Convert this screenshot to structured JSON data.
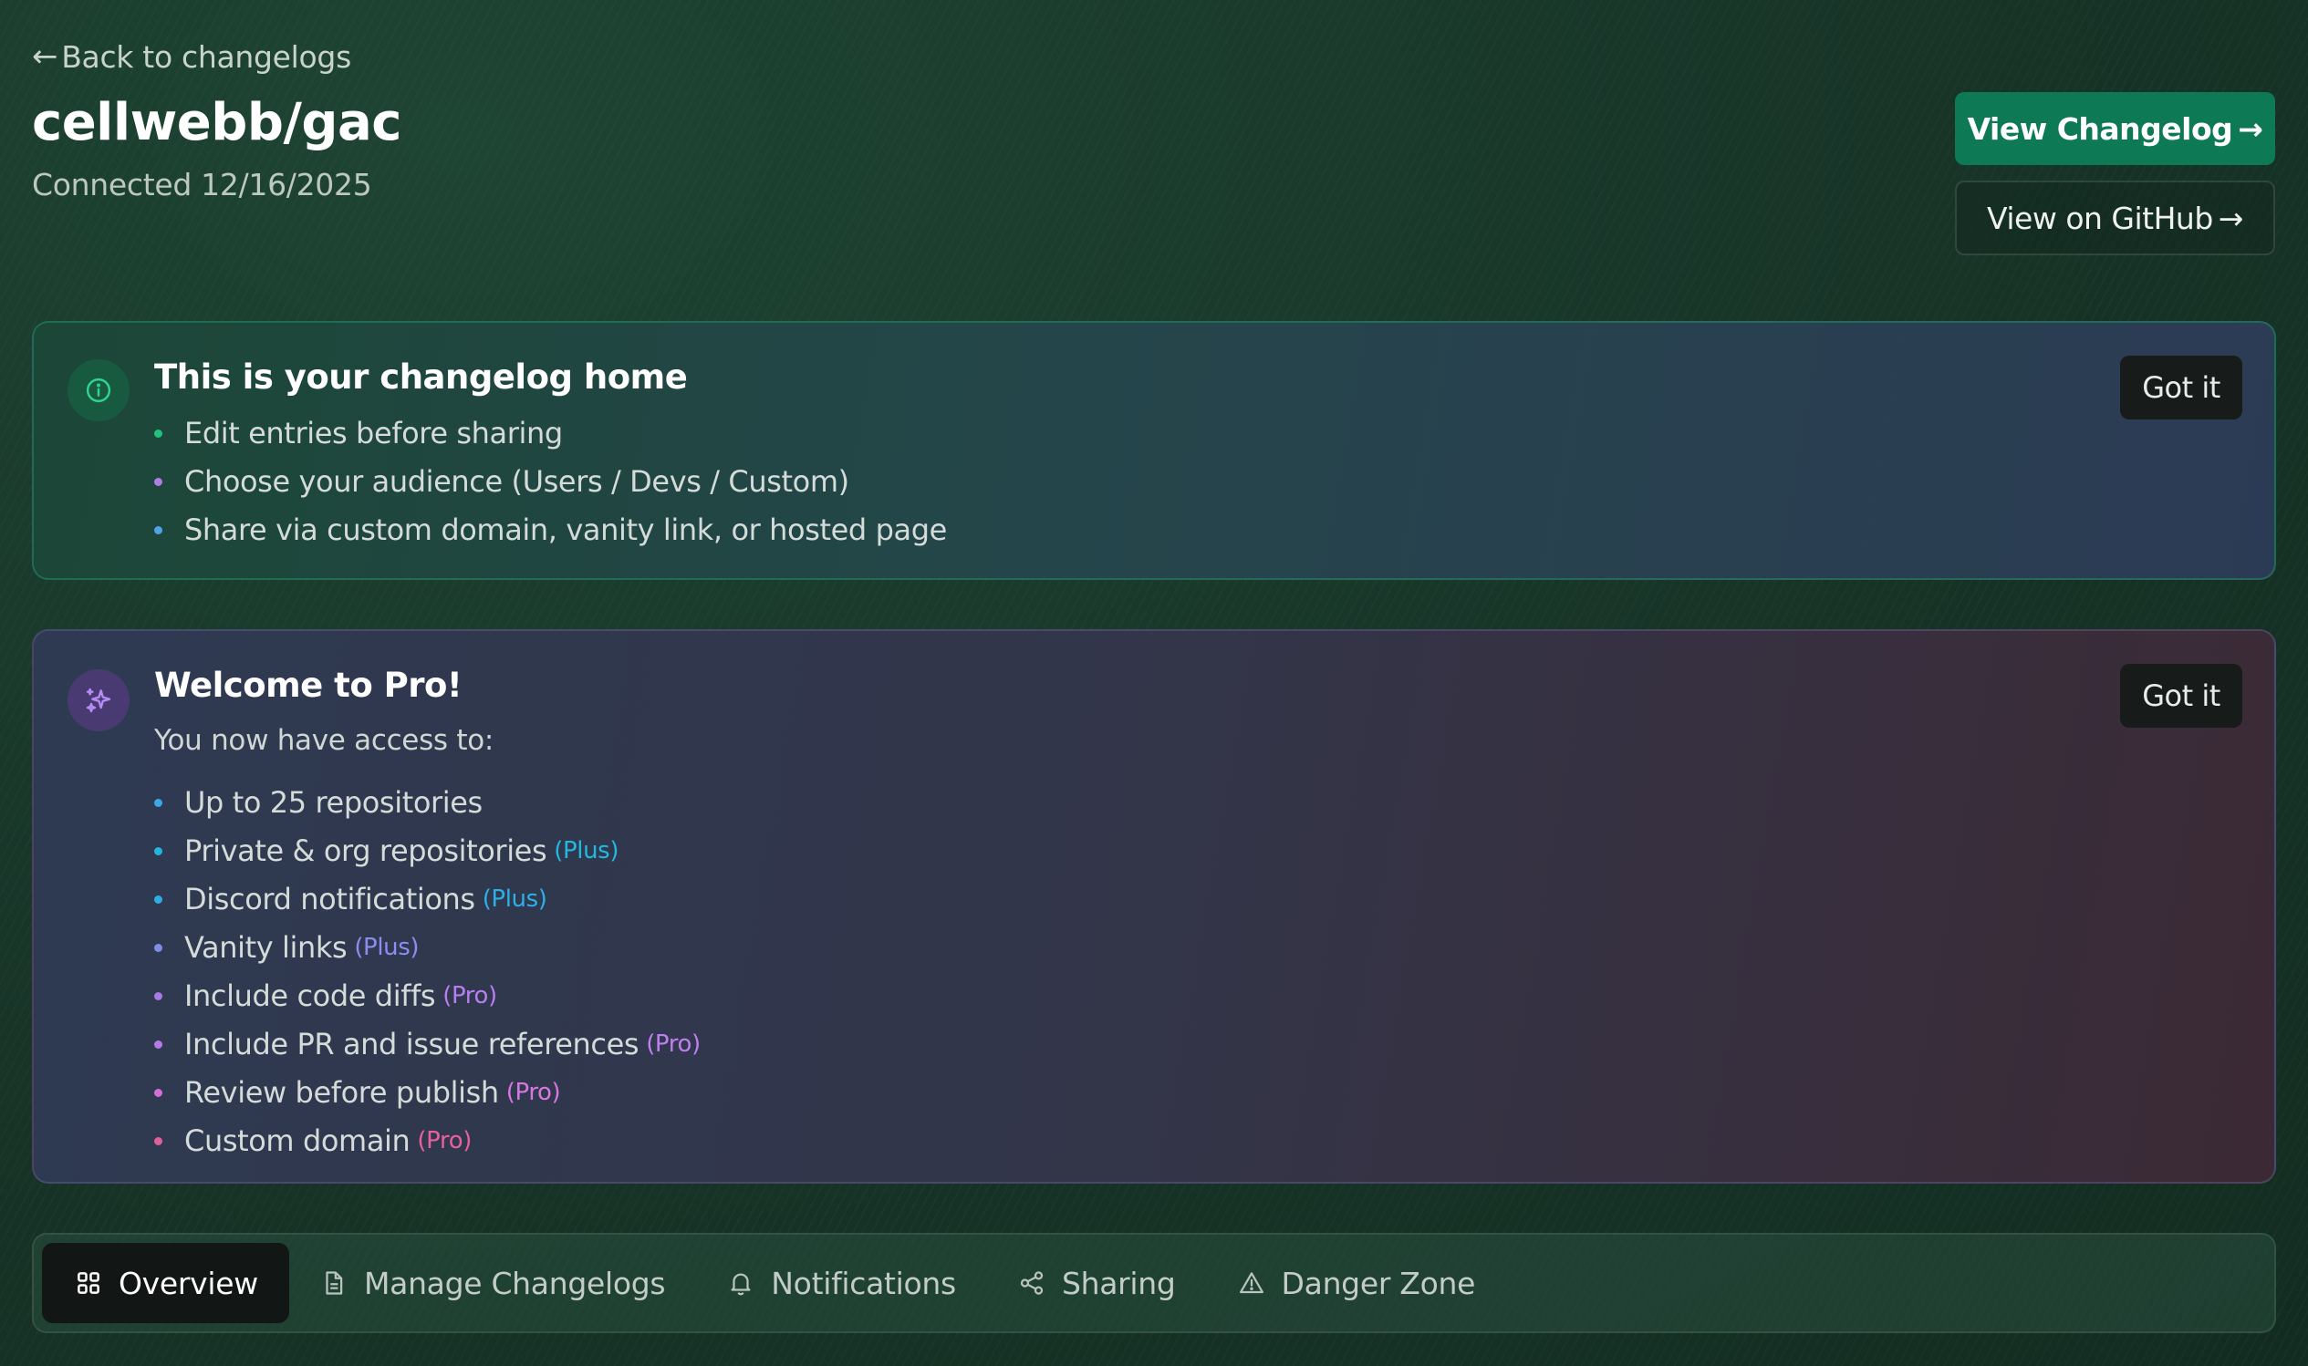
{
  "header": {
    "back_arrow": "←",
    "back_label": "Back to changelogs",
    "repo_name": "cellwebb/gac",
    "connected_label": "Connected 12/16/2025"
  },
  "actions": {
    "view_changelog_label": "View Changelog",
    "view_github_label": "View on GitHub",
    "arrow": "→"
  },
  "home_card": {
    "icon": "info-icon",
    "title": "This is your changelog home",
    "dismiss_label": "Got it",
    "items": [
      {
        "text": "Edit entries before sharing",
        "dot_color": "#22c27e"
      },
      {
        "text": "Choose your audience (Users / Devs / Custom)",
        "dot_color": "#b07de0"
      },
      {
        "text": "Share via custom domain, vanity link, or hosted page",
        "dot_color": "#4fa3e6"
      }
    ]
  },
  "pro_card": {
    "icon": "sparkles-icon",
    "title": "Welcome to Pro!",
    "subtitle": "You now have access to:",
    "dismiss_label": "Got it",
    "items": [
      {
        "text": "Up to 25 repositories",
        "tier": "",
        "dot_color": "#3aa8e8",
        "tier_color": ""
      },
      {
        "text": "Private & org repositories",
        "tier": "(Plus)",
        "dot_color": "#22b6dc",
        "tier_color": "#22b8e0"
      },
      {
        "text": "Discord notifications",
        "tier": "(Plus)",
        "dot_color": "#2eaee6",
        "tier_color": "#2cb0e8"
      },
      {
        "text": "Vanity links",
        "tier": "(Plus)",
        "dot_color": "#7f8ce8",
        "tier_color": "#8c8df0"
      },
      {
        "text": "Include code diffs",
        "tier": "(Pro)",
        "dot_color": "#a77ae6",
        "tier_color": "#b87ef0"
      },
      {
        "text": "Include PR and issue references",
        "tier": "(Pro)",
        "dot_color": "#b679e6",
        "tier_color": "#c07ef2"
      },
      {
        "text": "Review before publish",
        "tier": "(Pro)",
        "dot_color": "#d26ed6",
        "tier_color": "#d877e0"
      },
      {
        "text": "Custom domain",
        "tier": "(Pro)",
        "dot_color": "#e0609e",
        "tier_color": "#e9609f"
      }
    ]
  },
  "tabs": [
    {
      "label": "Overview",
      "icon": "grid-icon",
      "active": true
    },
    {
      "label": "Manage Changelogs",
      "icon": "document-icon",
      "active": false
    },
    {
      "label": "Notifications",
      "icon": "bell-icon",
      "active": false
    },
    {
      "label": "Sharing",
      "icon": "share-icon",
      "active": false
    },
    {
      "label": "Danger Zone",
      "icon": "warning-icon",
      "active": false
    }
  ]
}
